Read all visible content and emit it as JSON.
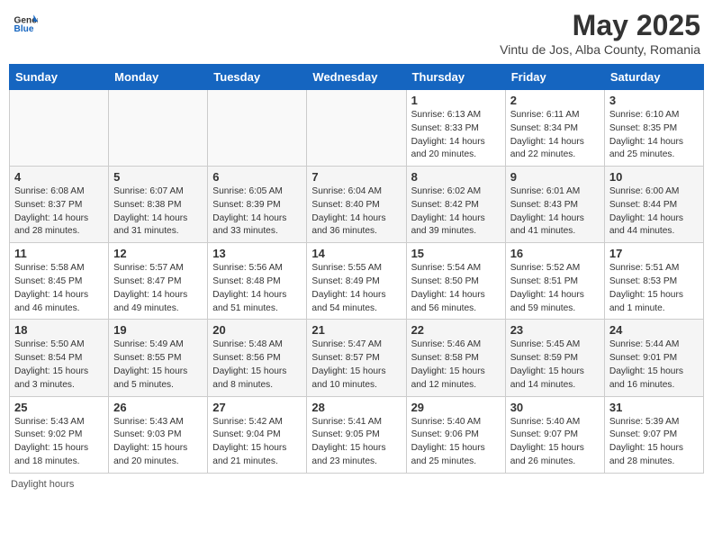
{
  "header": {
    "logo_general": "General",
    "logo_blue": "Blue",
    "month": "May 2025",
    "location": "Vintu de Jos, Alba County, Romania"
  },
  "days_of_week": [
    "Sunday",
    "Monday",
    "Tuesday",
    "Wednesday",
    "Thursday",
    "Friday",
    "Saturday"
  ],
  "footer": {
    "note": "Daylight hours"
  },
  "weeks": [
    [
      {
        "day": "",
        "info": ""
      },
      {
        "day": "",
        "info": ""
      },
      {
        "day": "",
        "info": ""
      },
      {
        "day": "",
        "info": ""
      },
      {
        "day": "1",
        "info": "Sunrise: 6:13 AM\nSunset: 8:33 PM\nDaylight: 14 hours\nand 20 minutes."
      },
      {
        "day": "2",
        "info": "Sunrise: 6:11 AM\nSunset: 8:34 PM\nDaylight: 14 hours\nand 22 minutes."
      },
      {
        "day": "3",
        "info": "Sunrise: 6:10 AM\nSunset: 8:35 PM\nDaylight: 14 hours\nand 25 minutes."
      }
    ],
    [
      {
        "day": "4",
        "info": "Sunrise: 6:08 AM\nSunset: 8:37 PM\nDaylight: 14 hours\nand 28 minutes."
      },
      {
        "day": "5",
        "info": "Sunrise: 6:07 AM\nSunset: 8:38 PM\nDaylight: 14 hours\nand 31 minutes."
      },
      {
        "day": "6",
        "info": "Sunrise: 6:05 AM\nSunset: 8:39 PM\nDaylight: 14 hours\nand 33 minutes."
      },
      {
        "day": "7",
        "info": "Sunrise: 6:04 AM\nSunset: 8:40 PM\nDaylight: 14 hours\nand 36 minutes."
      },
      {
        "day": "8",
        "info": "Sunrise: 6:02 AM\nSunset: 8:42 PM\nDaylight: 14 hours\nand 39 minutes."
      },
      {
        "day": "9",
        "info": "Sunrise: 6:01 AM\nSunset: 8:43 PM\nDaylight: 14 hours\nand 41 minutes."
      },
      {
        "day": "10",
        "info": "Sunrise: 6:00 AM\nSunset: 8:44 PM\nDaylight: 14 hours\nand 44 minutes."
      }
    ],
    [
      {
        "day": "11",
        "info": "Sunrise: 5:58 AM\nSunset: 8:45 PM\nDaylight: 14 hours\nand 46 minutes."
      },
      {
        "day": "12",
        "info": "Sunrise: 5:57 AM\nSunset: 8:47 PM\nDaylight: 14 hours\nand 49 minutes."
      },
      {
        "day": "13",
        "info": "Sunrise: 5:56 AM\nSunset: 8:48 PM\nDaylight: 14 hours\nand 51 minutes."
      },
      {
        "day": "14",
        "info": "Sunrise: 5:55 AM\nSunset: 8:49 PM\nDaylight: 14 hours\nand 54 minutes."
      },
      {
        "day": "15",
        "info": "Sunrise: 5:54 AM\nSunset: 8:50 PM\nDaylight: 14 hours\nand 56 minutes."
      },
      {
        "day": "16",
        "info": "Sunrise: 5:52 AM\nSunset: 8:51 PM\nDaylight: 14 hours\nand 59 minutes."
      },
      {
        "day": "17",
        "info": "Sunrise: 5:51 AM\nSunset: 8:53 PM\nDaylight: 15 hours\nand 1 minute."
      }
    ],
    [
      {
        "day": "18",
        "info": "Sunrise: 5:50 AM\nSunset: 8:54 PM\nDaylight: 15 hours\nand 3 minutes."
      },
      {
        "day": "19",
        "info": "Sunrise: 5:49 AM\nSunset: 8:55 PM\nDaylight: 15 hours\nand 5 minutes."
      },
      {
        "day": "20",
        "info": "Sunrise: 5:48 AM\nSunset: 8:56 PM\nDaylight: 15 hours\nand 8 minutes."
      },
      {
        "day": "21",
        "info": "Sunrise: 5:47 AM\nSunset: 8:57 PM\nDaylight: 15 hours\nand 10 minutes."
      },
      {
        "day": "22",
        "info": "Sunrise: 5:46 AM\nSunset: 8:58 PM\nDaylight: 15 hours\nand 12 minutes."
      },
      {
        "day": "23",
        "info": "Sunrise: 5:45 AM\nSunset: 8:59 PM\nDaylight: 15 hours\nand 14 minutes."
      },
      {
        "day": "24",
        "info": "Sunrise: 5:44 AM\nSunset: 9:01 PM\nDaylight: 15 hours\nand 16 minutes."
      }
    ],
    [
      {
        "day": "25",
        "info": "Sunrise: 5:43 AM\nSunset: 9:02 PM\nDaylight: 15 hours\nand 18 minutes."
      },
      {
        "day": "26",
        "info": "Sunrise: 5:43 AM\nSunset: 9:03 PM\nDaylight: 15 hours\nand 20 minutes."
      },
      {
        "day": "27",
        "info": "Sunrise: 5:42 AM\nSunset: 9:04 PM\nDaylight: 15 hours\nand 21 minutes."
      },
      {
        "day": "28",
        "info": "Sunrise: 5:41 AM\nSunset: 9:05 PM\nDaylight: 15 hours\nand 23 minutes."
      },
      {
        "day": "29",
        "info": "Sunrise: 5:40 AM\nSunset: 9:06 PM\nDaylight: 15 hours\nand 25 minutes."
      },
      {
        "day": "30",
        "info": "Sunrise: 5:40 AM\nSunset: 9:07 PM\nDaylight: 15 hours\nand 26 minutes."
      },
      {
        "day": "31",
        "info": "Sunrise: 5:39 AM\nSunset: 9:07 PM\nDaylight: 15 hours\nand 28 minutes."
      }
    ]
  ]
}
